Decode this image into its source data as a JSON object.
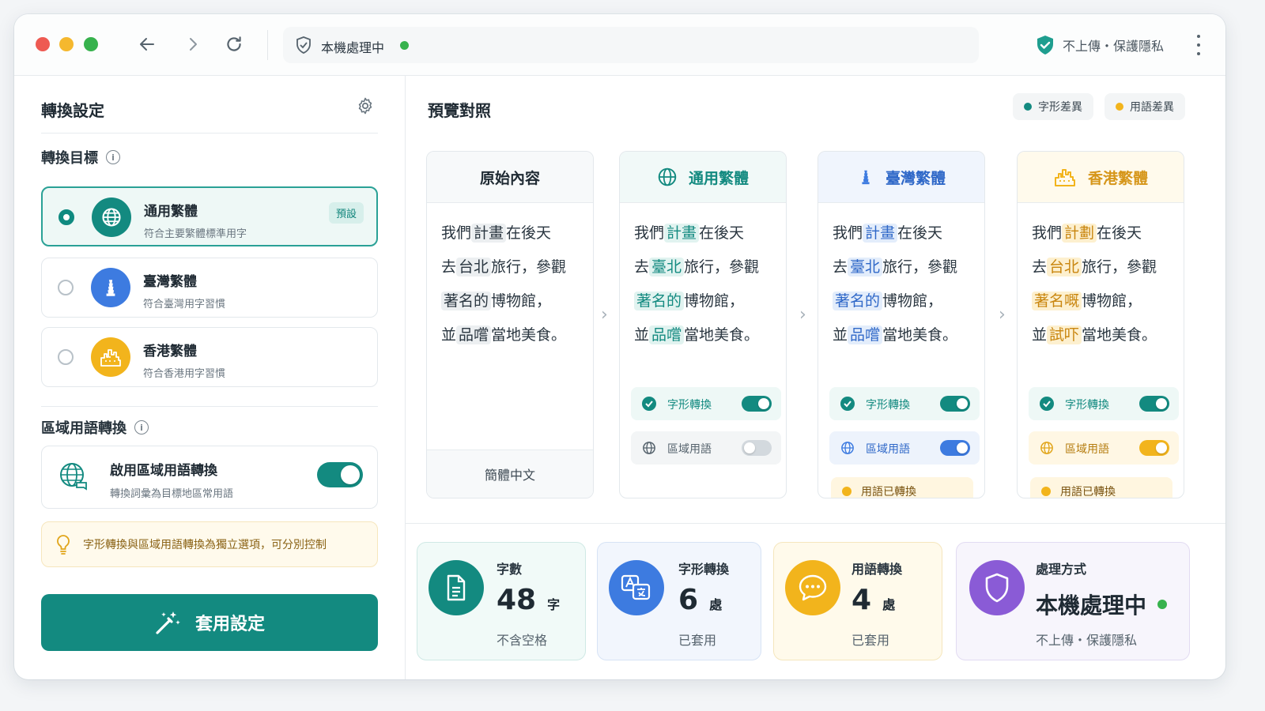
{
  "browser": {
    "address_status": "本機處理中",
    "privacy_label": "不上傳・保護隱私"
  },
  "settings": {
    "title": "轉換設定",
    "target_label": "轉換目標",
    "options": [
      {
        "name": "通用繁體",
        "desc": "符合主要繁體標準用字",
        "badge": "預設",
        "selected": true
      },
      {
        "name": "臺灣繁體",
        "desc": "符合臺灣用字習慣",
        "selected": false
      },
      {
        "name": "香港繁體",
        "desc": "符合香港用字習慣",
        "selected": false
      }
    ],
    "regional_label": "區域用語轉換",
    "regional_card": {
      "name": "啟用區域用語轉換",
      "desc": "轉換詞彙為目標地區常用語",
      "enabled": true
    },
    "tip": "字形轉換與區域用語轉換為獨立選項，可分別控制",
    "apply_button": "套用設定"
  },
  "preview": {
    "title": "預覽對照",
    "legend": [
      {
        "label": "字形差異",
        "color": "#138a80"
      },
      {
        "label": "用語差異",
        "color": "#f2b41c"
      }
    ],
    "columns": [
      {
        "header": "原始內容",
        "lines": [
          [
            {
              "t": "我們"
            },
            {
              "t": "計畫",
              "hl": "g"
            },
            {
              "t": "在後天"
            }
          ],
          [
            {
              "t": "去"
            },
            {
              "t": "台北",
              "hl": "g"
            },
            {
              "t": "旅行，參觀"
            }
          ],
          [
            {
              "t": "著名的",
              "hl": "g"
            },
            {
              "t": "博物館，"
            }
          ],
          [
            {
              "t": "並"
            },
            {
              "t": "品嚐",
              "hl": "g"
            },
            {
              "t": "當地美食。"
            }
          ]
        ],
        "footer": "簡體中文"
      },
      {
        "header": "通用繁體",
        "lines": [
          [
            {
              "t": "我們"
            },
            {
              "t": "計畫",
              "hl": "t"
            },
            {
              "t": "在後天"
            }
          ],
          [
            {
              "t": "去"
            },
            {
              "t": "臺北",
              "hl": "t"
            },
            {
              "t": "旅行，參觀"
            }
          ],
          [
            {
              "t": "著名的",
              "hl": "t"
            },
            {
              "t": "博物館，"
            }
          ],
          [
            {
              "t": "並"
            },
            {
              "t": "品嚐",
              "hl": "t"
            },
            {
              "t": "當地美食。"
            }
          ]
        ],
        "toggles": [
          {
            "label": "字形轉換",
            "on": true
          },
          {
            "label": "區域用語",
            "on": false
          }
        ]
      },
      {
        "header": "臺灣繁體",
        "lines": [
          [
            {
              "t": "我們"
            },
            {
              "t": "計畫",
              "hl": "b"
            },
            {
              "t": "在後天"
            }
          ],
          [
            {
              "t": "去"
            },
            {
              "t": "臺北",
              "hl": "b"
            },
            {
              "t": "旅行，參觀"
            }
          ],
          [
            {
              "t": "著名的",
              "hl": "b"
            },
            {
              "t": "博物館，"
            }
          ],
          [
            {
              "t": "並"
            },
            {
              "t": "品嚐",
              "hl": "b"
            },
            {
              "t": "當地美食。"
            }
          ]
        ],
        "toggles": [
          {
            "label": "字形轉換",
            "on": true
          },
          {
            "label": "區域用語",
            "on": true
          }
        ],
        "status": "用語已轉換"
      },
      {
        "header": "香港繁體",
        "lines": [
          [
            {
              "t": "我們"
            },
            {
              "t": "計劃",
              "hl": "o"
            },
            {
              "t": "在後天"
            }
          ],
          [
            {
              "t": "去"
            },
            {
              "t": "台北",
              "hl": "o"
            },
            {
              "t": "旅行，參觀"
            }
          ],
          [
            {
              "t": "著名嘅",
              "hl": "o"
            },
            {
              "t": "博物館，"
            }
          ],
          [
            {
              "t": "並"
            },
            {
              "t": "試吓",
              "hl": "o"
            },
            {
              "t": "當地美食。"
            }
          ]
        ],
        "toggles": [
          {
            "label": "字形轉換",
            "on": true
          },
          {
            "label": "區域用語",
            "on": true
          }
        ],
        "status": "用語已轉換"
      }
    ]
  },
  "stats": [
    {
      "label": "字數",
      "value": "48",
      "unit": "字",
      "sub": "不含空格"
    },
    {
      "label": "字形轉換",
      "value": "6",
      "unit": "處",
      "sub": "已套用"
    },
    {
      "label": "用語轉換",
      "value": "4",
      "unit": "處",
      "sub": "已套用"
    },
    {
      "label": "處理方式",
      "value": "本機處理中",
      "sub": "不上傳・保護隱私"
    }
  ],
  "colors": {
    "teal": "#138a80",
    "blue": "#3d7be0",
    "orange": "#f2b41c",
    "purple": "#8a5bd6",
    "green": "#37b24d"
  }
}
